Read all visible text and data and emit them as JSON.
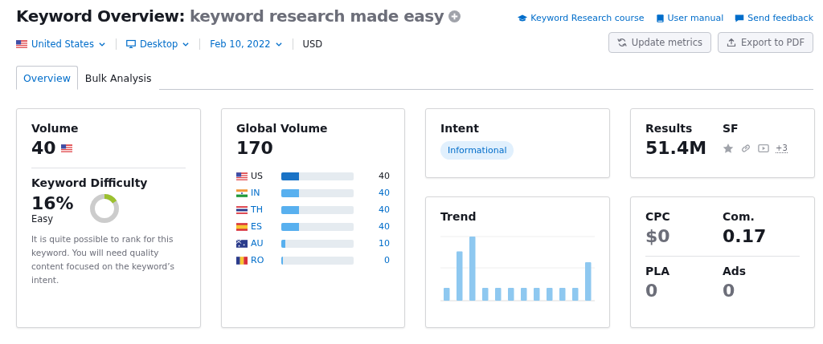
{
  "header": {
    "title": "Keyword Overview:",
    "keyword": "keyword research made easy",
    "links": [
      {
        "kind": "course",
        "label": "Keyword Research course"
      },
      {
        "kind": "manual",
        "label": "User manual"
      },
      {
        "kind": "feedback",
        "label": "Send feedback"
      }
    ]
  },
  "filters": {
    "country": "United States",
    "device": "Desktop",
    "date": "Feb 10, 2022",
    "currency": "USD"
  },
  "buttons": [
    {
      "kind": "refresh",
      "label": "Update metrics"
    },
    {
      "kind": "export",
      "label": "Export to PDF"
    }
  ],
  "tabs": [
    {
      "label": "Overview",
      "selected": true
    },
    {
      "label": "Bulk Analysis",
      "selected": false
    }
  ],
  "volume": {
    "title": "Volume",
    "value": "40"
  },
  "difficulty": {
    "title": "Keyword Difficulty",
    "value": "16%",
    "level": 0.16,
    "rating": "Easy",
    "description": "It is quite possible to rank for this keyword. You will need quality content focused on the keyword’s intent."
  },
  "global_volume": {
    "title": "Global Volume",
    "value": "170",
    "rows": [
      {
        "kind": "us",
        "code": "US",
        "level": 0.24,
        "value": "40",
        "selected": true
      },
      {
        "kind": "in",
        "code": "IN",
        "level": 0.24,
        "value": "40",
        "selected": false
      },
      {
        "kind": "th",
        "code": "TH",
        "level": 0.24,
        "value": "40",
        "selected": false
      },
      {
        "kind": "es",
        "code": "ES",
        "level": 0.24,
        "value": "40",
        "selected": false
      },
      {
        "kind": "au",
        "code": "AU",
        "level": 0.06,
        "value": "10",
        "selected": false
      },
      {
        "kind": "ro",
        "code": "RO",
        "level": 0.02,
        "value": "0",
        "selected": false
      }
    ]
  },
  "intent": {
    "title": "Intent",
    "tag": "Informational"
  },
  "trend": {
    "title": "Trend"
  },
  "results": {
    "title": "Results",
    "value": "51.4M",
    "sf_title": "SF",
    "sf_more": "+3"
  },
  "metrics": [
    {
      "label": "CPC",
      "value": "$0",
      "muted": true
    },
    {
      "label": "Com.",
      "value": "0.17",
      "muted": false
    },
    {
      "label": "PLA",
      "value": "0",
      "muted": true
    },
    {
      "label": "Ads",
      "value": "0",
      "muted": true
    }
  ]
}
